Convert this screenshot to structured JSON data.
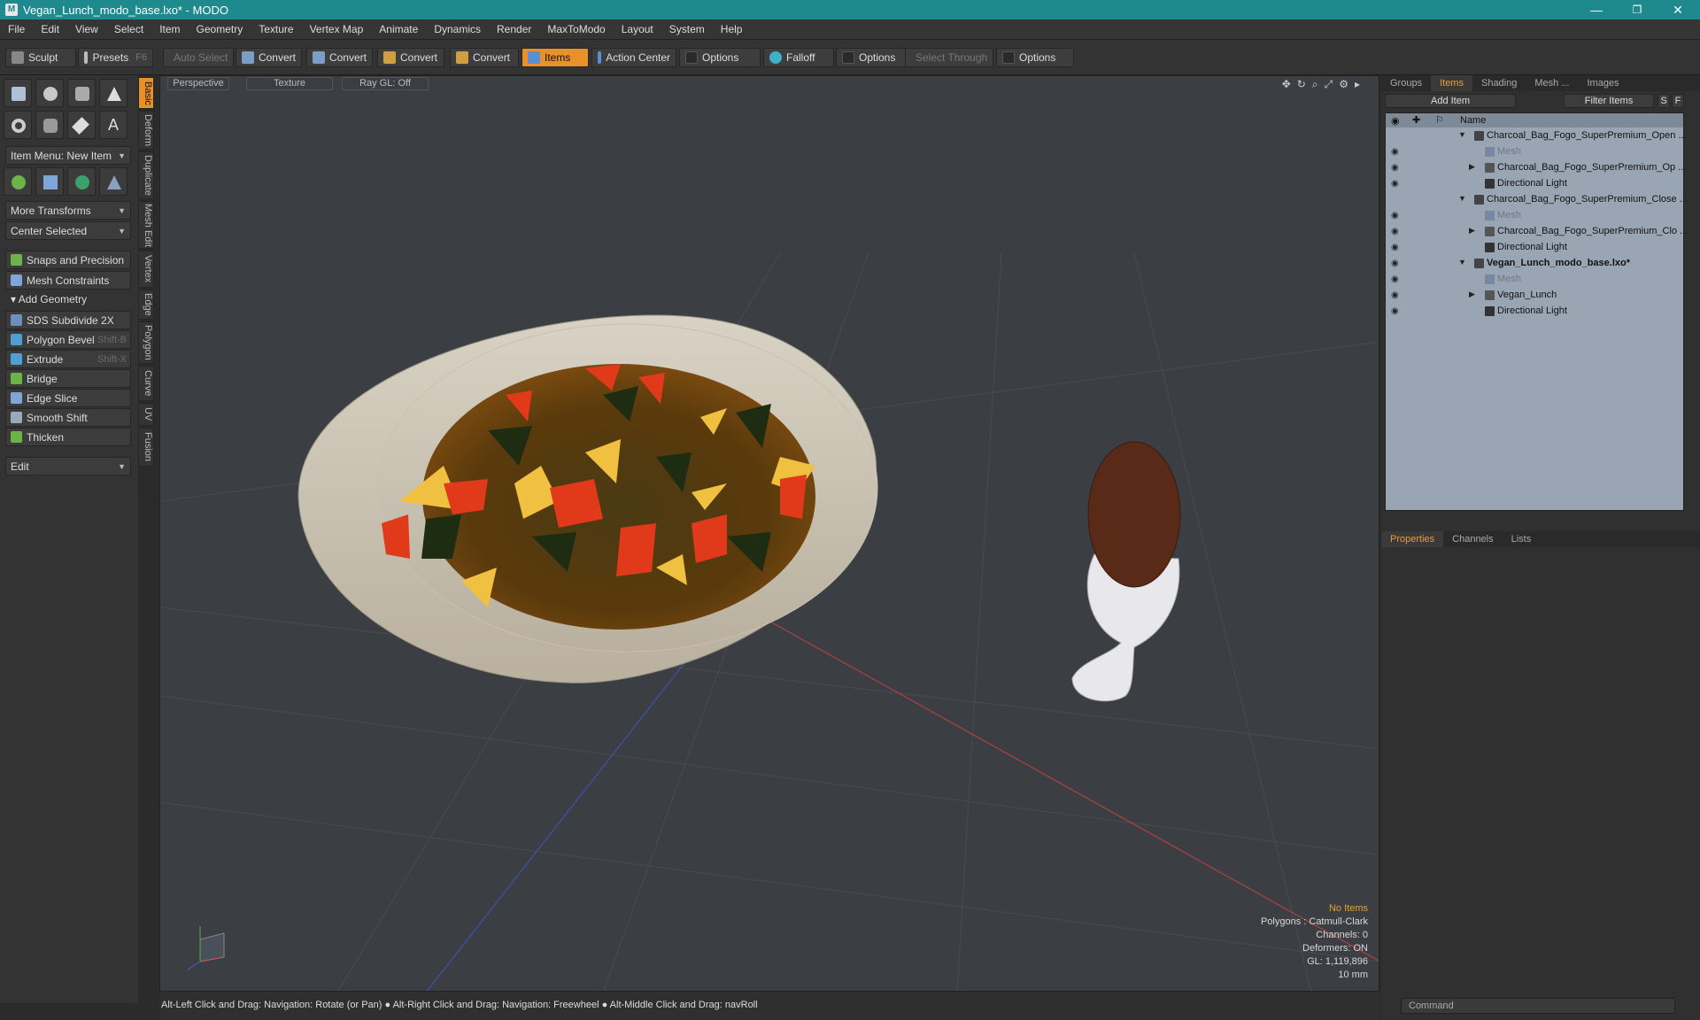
{
  "window": {
    "title": "Vegan_Lunch_modo_base.lxo* - MODO",
    "minimize": "—",
    "maximize": "❐",
    "close": "✕"
  },
  "menu": [
    "File",
    "Edit",
    "View",
    "Select",
    "Item",
    "Geometry",
    "Texture",
    "Vertex Map",
    "Animate",
    "Dynamics",
    "Render",
    "MaxToModo",
    "Layout",
    "System",
    "Help"
  ],
  "toolbar": {
    "sculpt": "Sculpt",
    "presets": "Presets",
    "presets_key": "F6",
    "auto_select": "Auto Select",
    "convert1": "Convert",
    "convert2": "Convert",
    "convert3": "Convert",
    "convert4": "Convert",
    "items": "Items",
    "action_center": "Action Center",
    "options1": "Options",
    "falloff": "Falloff",
    "options2": "Options",
    "select_through": "Select Through",
    "options3": "Options"
  },
  "left": {
    "item_menu": "Item Menu: New Item",
    "more_transforms": "More Transforms",
    "center_selected": "Center Selected",
    "snaps": "Snaps and Precision",
    "mesh_constraints": "Mesh Constraints",
    "add_geometry": "Add Geometry",
    "sds": "SDS Subdivide 2X",
    "polygon_bevel": "Polygon Bevel",
    "polygon_bevel_key": "Shift-B",
    "extrude": "Extrude",
    "extrude_key": "Shift-X",
    "bridge": "Bridge",
    "edge_slice": "Edge Slice",
    "smooth_shift": "Smooth Shift",
    "thicken": "Thicken",
    "edit": "Edit"
  },
  "vtabs": [
    "Basic",
    "Deform",
    "Duplicate",
    "Mesh Edit",
    "Vertex",
    "Edge",
    "Polygon",
    "Curve",
    "UV",
    "Fusion"
  ],
  "viewport": {
    "perspective": "Perspective",
    "texture": "Texture",
    "raygl": "Ray GL: Off",
    "no_items": "No Items",
    "polygons": "Polygons : Catmull-Clark",
    "channels": "Channels: 0",
    "deformers": "Deformers: ON",
    "gl": "GL: 1,119,896",
    "scale": "10 mm"
  },
  "status": "Alt-Left Click and Drag: Navigation: Rotate (or Pan) ● Alt-Right Click and Drag: Navigation: Freewheel ● Alt-Middle Click and Drag: navRoll",
  "right": {
    "tabs": [
      "Groups",
      "Items",
      "Shading",
      "Mesh ...",
      "Images"
    ],
    "add_item": "Add Item",
    "filter_items": "Filter Items",
    "s": "S",
    "f": "F",
    "name_col": "Name",
    "rows": [
      {
        "label": "Charcoal_Bag_Fogo_SuperPremium_Open ...",
        "type": "scene"
      },
      {
        "label": "Mesh",
        "type": "mesh"
      },
      {
        "label": "Charcoal_Bag_Fogo_SuperPremium_Op ...",
        "type": "child"
      },
      {
        "label": "Directional Light",
        "type": "light"
      },
      {
        "label": "Charcoal_Bag_Fogo_SuperPremium_Close ...",
        "type": "scene"
      },
      {
        "label": "Mesh",
        "type": "mesh"
      },
      {
        "label": "Charcoal_Bag_Fogo_SuperPremium_Clo ...",
        "type": "child"
      },
      {
        "label": "Directional Light",
        "type": "light"
      },
      {
        "label": "Vegan_Lunch_modo_base.lxo*",
        "type": "scene_bold"
      },
      {
        "label": "Mesh",
        "type": "mesh"
      },
      {
        "label": "Vegan_Lunch",
        "type": "child"
      },
      {
        "label": "Directional Light",
        "type": "light"
      }
    ],
    "bottom_tabs": [
      "Properties",
      "Channels",
      "Lists"
    ],
    "command": "Command"
  }
}
